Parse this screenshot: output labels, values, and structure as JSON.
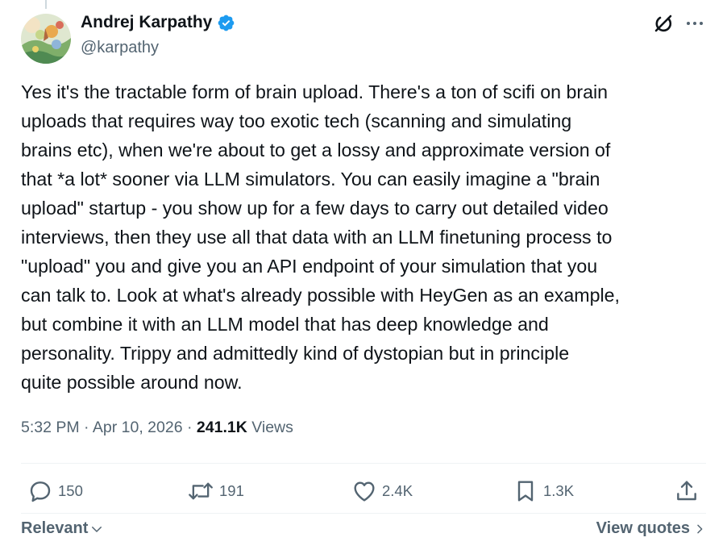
{
  "author": {
    "display_name": "Andrej Karpathy",
    "handle": "@karpathy",
    "verified": true,
    "avatar": "avatar-illustration"
  },
  "tweet": {
    "text": "Yes it's the tractable form of brain upload. There's a ton of scifi on brain\nuploads that requires way too exotic tech (scanning and simulating\nbrains etc), when we're about to get a lossy and approximate version of\nthat *a lot* sooner via LLM simulators. You can easily imagine a \"brain\nupload\" startup - you show up for a few days to carry out detailed video\ninterviews, then they use all that data with an LLM finetuning process to\n\"upload\" you and give you an API endpoint of your simulation that you\ncan talk to. Look at what's already possible with HeyGen as an example,\nbut combine it with an LLM model that has deep knowledge and\npersonality. Trippy and admittedly kind of dystopian but in principle\nquite possible around now.",
    "time": "5:32 PM",
    "date": "Apr 10, 2026",
    "separator": "·",
    "views_count": "241.1K",
    "views_label": "Views"
  },
  "actions": {
    "replies": "150",
    "reposts": "191",
    "likes": "2.4K",
    "bookmarks": "1.3K"
  },
  "footer": {
    "sort_label": "Relevant",
    "view_quotes_label": "View quotes"
  },
  "icons": {
    "verified": "verified-badge-icon",
    "grok": "grok-icon",
    "more": "more-icon",
    "reply": "reply-icon",
    "repost": "repost-icon",
    "like": "like-icon",
    "bookmark": "bookmark-icon",
    "share": "share-icon"
  },
  "colors": {
    "text": "#0f1419",
    "secondary": "#536471",
    "verified": "#1d9bf0",
    "divider": "#eff3f4"
  }
}
